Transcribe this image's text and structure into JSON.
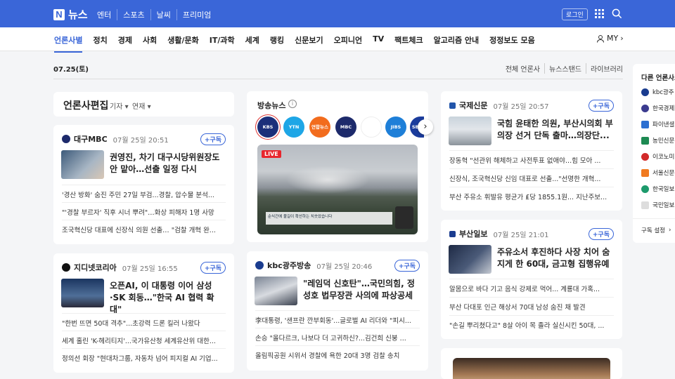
{
  "top": {
    "logo_text": "뉴스",
    "nav": [
      "엔터",
      "스포츠",
      "날씨",
      "프리미엄"
    ],
    "login": "로그인"
  },
  "categories": [
    "언론사별",
    "정치",
    "경제",
    "사회",
    "생활/문화",
    "IT/과학",
    "세계",
    "랭킹",
    "신문보기",
    "오피니언",
    "TV",
    "팩트체크",
    "알고리즘 안내",
    "정정보도 모음"
  ],
  "my": "MY",
  "date": "07.25(토)",
  "date_links": [
    "전체 언론사",
    "뉴스스탠드",
    "라이브러리"
  ],
  "section": {
    "title": "언론사편집",
    "filter1": "기자",
    "filter2": "연재"
  },
  "subscribe_label": "+구독",
  "cards": [
    {
      "source": "대구MBC",
      "time": "07월 25일 20:51",
      "headline": "권영진, 차기 대구시당위원장도 안 맡아…선출 일정 다시",
      "items": [
        "'경산 방화' 숨진 주민 27일 부검...경찰, 압수물 분석...",
        "\"'경찰 부르자' 직후 시너 뿌려\"…화상 피해자 1명 사망",
        "조국혁신당 대표에 신장식 의원 선출… \"검찰 개혁 완..."
      ],
      "logo_color": "#1d2a6b"
    },
    {
      "source": "지디넷코리아",
      "time": "07월 25일 16:55",
      "headline": "오픈AI, 이 대통령 이어 삼성·SK 회동…\"한국 AI 협력 확대\"",
      "items": [
        "\"한번 뜨면 50대 격추\"...초강력 드론 킬러 나왔다",
        "세계 홀린 'K-헤리티지'...국가유산청 세계유산위 대한...",
        "정의선 회장 \"현대차그룹, 자동차 넘어 피지컬 AI 기업..."
      ],
      "logo_color": "#111111"
    },
    {
      "source": "kbc광주방송",
      "time": "07월 25일 20:46",
      "headline": "\"레임덕 신호탄\"…국민의힘, 정성호 법무장관 사의에 파상공세",
      "items": [
        "李대통령, '샌프란 깐부회동'...글로벌 AI 리더와 \"피시...",
        "손승 \"올다르크, 나보다 더 고귀하신?...김건희 신붕 ...",
        "올림픽공원 시위서 경찰에 욕한 20대 3명 검찰 송치"
      ],
      "logo_color": "#1a3c8f"
    },
    {
      "source": "국제신문",
      "time": "07월 25일 20:57",
      "headline": "국힘 윤태한 의원, 부산시의회 부의장 선거 단독 출마…의장단...",
      "items": [
        "장동혁 \"선관위 해체하고 사전투표 없애야...힘 모아 ...",
        "신장식, 조국혁신당 신임 대표로 선출...\"선명한 개혁...",
        "부산 주유소 휘발유 평균가 ₤당 1855.1원... 지난주보..."
      ],
      "logo_color": "#2255aa"
    },
    {
      "source": "부산일보",
      "time": "07월 25일 21:01",
      "headline": "주유소서 후진하다 사장 치어 숨지게 한 60대, 금고형 집행유예",
      "items": [
        "알몸으로 바다 기고 음식 강제로 먹어... 계룡대 가혹...",
        "부산 다대포 인근 해상서 70대 남성 숨진 채 발견",
        "\"손길 뿌리쳤다고\" 8살 아이 목 졸라 실신시킨 50대, ..."
      ],
      "logo_color": "#1a3c8f"
    }
  ],
  "broadcast": {
    "title": "방송뉴스",
    "logos": [
      {
        "name": "KBS NEWS",
        "color": "#1b2f7a"
      },
      {
        "name": "YTN",
        "color": "#1ea6e6"
      },
      {
        "name": "연합뉴스TV",
        "color": "#f26c1d"
      },
      {
        "name": "MBC NEWS",
        "color": "#1d2a6b"
      },
      {
        "name": "",
        "color": "#ffffff"
      },
      {
        "name": "JIBS NEWS",
        "color": "#1e7fd8"
      },
      {
        "name": "SBS",
        "color": "#1b3c9c"
      }
    ],
    "live": "LIVE",
    "caption": "순식간에 불길이 확산하는 치솟았습니다"
  },
  "right": {
    "title": "다른 언론사보기",
    "items": [
      {
        "name": "kbc광주",
        "color": "#1a3c8f"
      },
      {
        "name": "한국경제",
        "color": "#3b3b8f"
      },
      {
        "name": "파이낸셜",
        "color": "#2b6fd1"
      },
      {
        "name": "농민신문",
        "color": "#1d8a52"
      },
      {
        "name": "이코노미",
        "color": "#d22a2a"
      },
      {
        "name": "서울신문",
        "color": "#f07a20"
      },
      {
        "name": "한국일보",
        "color": "#1d9a6c"
      },
      {
        "name": "국민일보",
        "color": "#dddddd"
      }
    ],
    "settings": "구독 설정"
  }
}
